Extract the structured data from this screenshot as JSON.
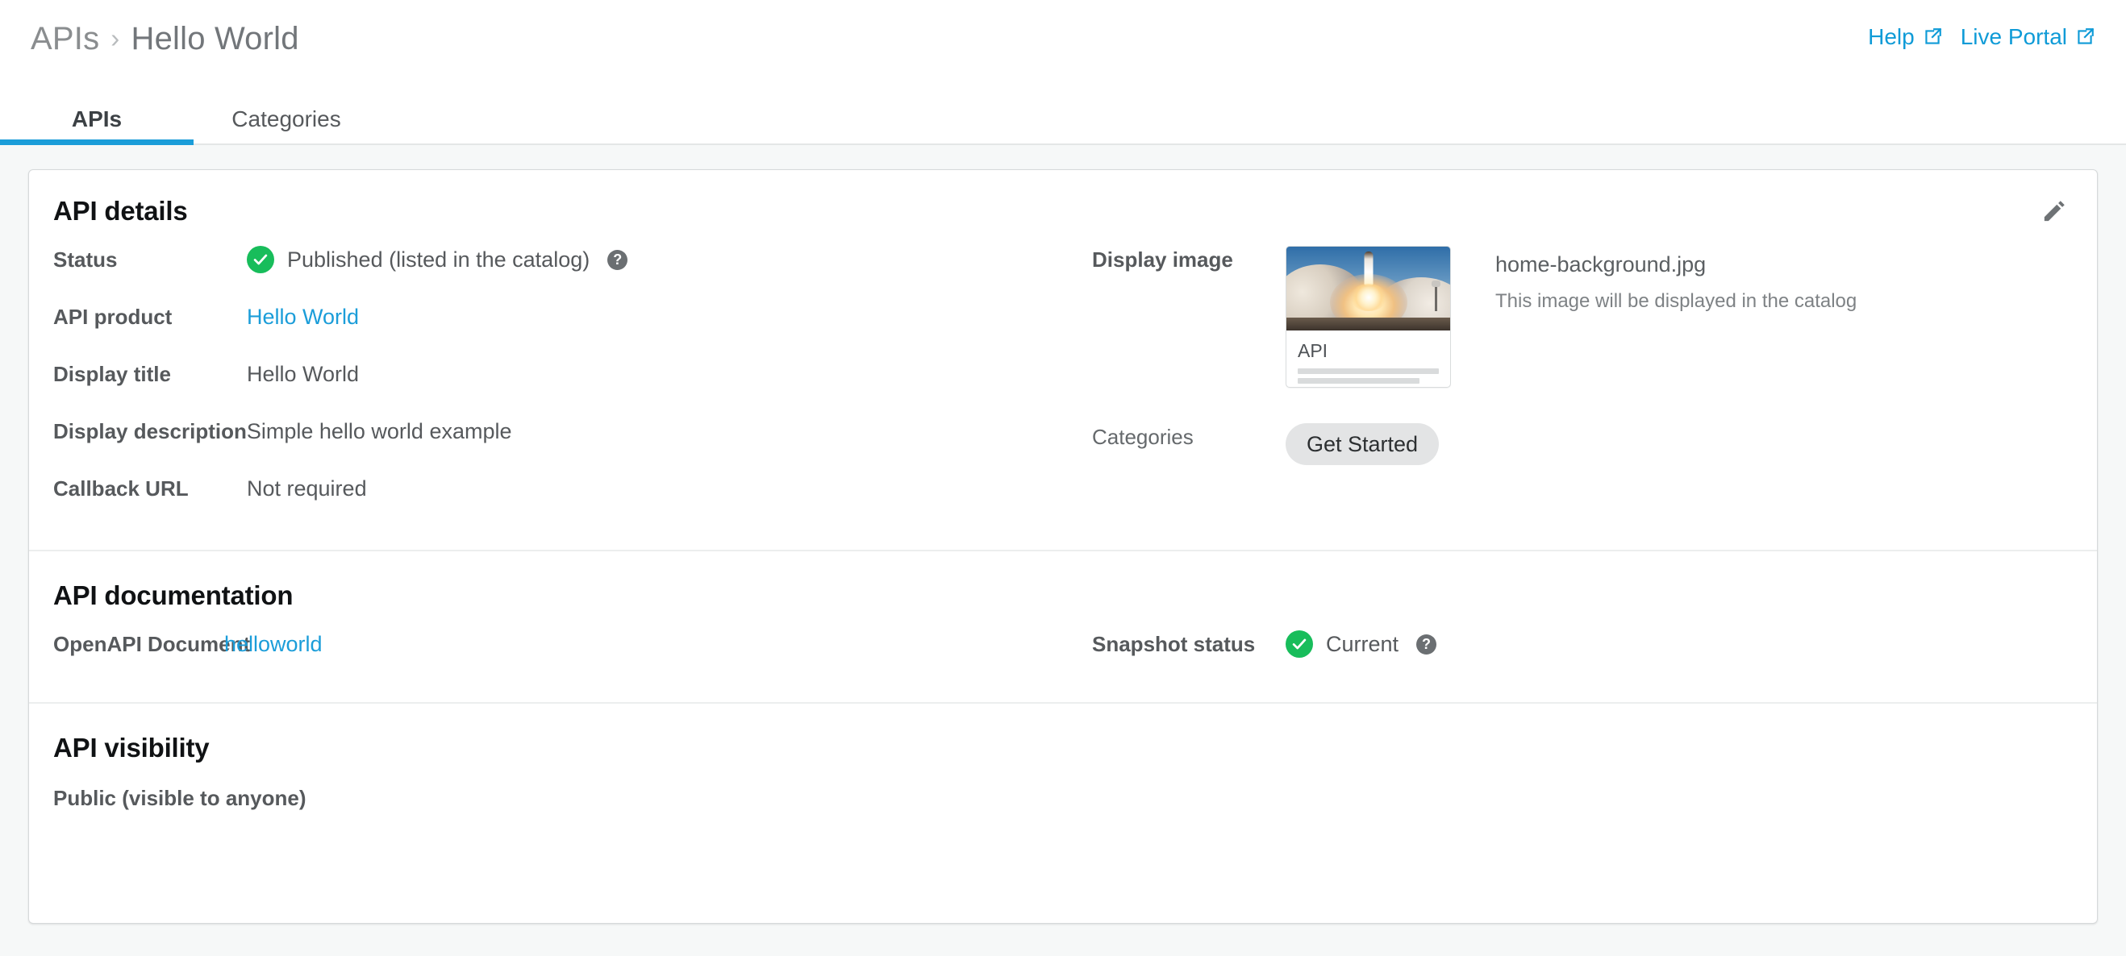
{
  "header": {
    "breadcrumb": {
      "parent": "APIs",
      "separator": "›",
      "current": "Hello World"
    },
    "links": [
      {
        "label": "Help",
        "icon": "external-link-icon"
      },
      {
        "label": "Live Portal",
        "icon": "external-link-icon"
      }
    ]
  },
  "tabs": [
    {
      "label": "APIs",
      "active": true
    },
    {
      "label": "Categories",
      "active": false
    }
  ],
  "details": {
    "title": "API details",
    "edit_icon": "pencil-icon",
    "left_rows": [
      {
        "label": "Status",
        "value": "Published (listed in the catalog)",
        "icon": "check-circle-icon",
        "help": "?"
      },
      {
        "label": "API product",
        "value": "Hello World",
        "type": "link"
      },
      {
        "label": "Display title",
        "value": "Hello World"
      },
      {
        "label": "Display description",
        "value": "Simple hello world example"
      },
      {
        "label": "Callback URL",
        "value": "Not required"
      }
    ],
    "display_image": {
      "label": "Display image",
      "thumbnail_card_title": "API",
      "filename": "home-background.jpg",
      "hint": "This image will be displayed in the catalog"
    },
    "categories": {
      "label": "Categories",
      "chips": [
        "Get Started"
      ]
    }
  },
  "documentation": {
    "title": "API documentation",
    "openapi_label": "OpenAPI Document",
    "openapi_value": "helloworld",
    "snapshot_label": "Snapshot status",
    "snapshot_value": "Current",
    "snapshot_icon": "check-circle-icon",
    "snapshot_help": "?"
  },
  "visibility": {
    "title": "API visibility",
    "value": "Public (visible to anyone)"
  },
  "colors": {
    "accent": "#1b9dd9",
    "link": "#0f9bd7",
    "success": "#18bd5b",
    "page_bg": "#f6f8f8",
    "help_icon": "#6b6f72"
  }
}
